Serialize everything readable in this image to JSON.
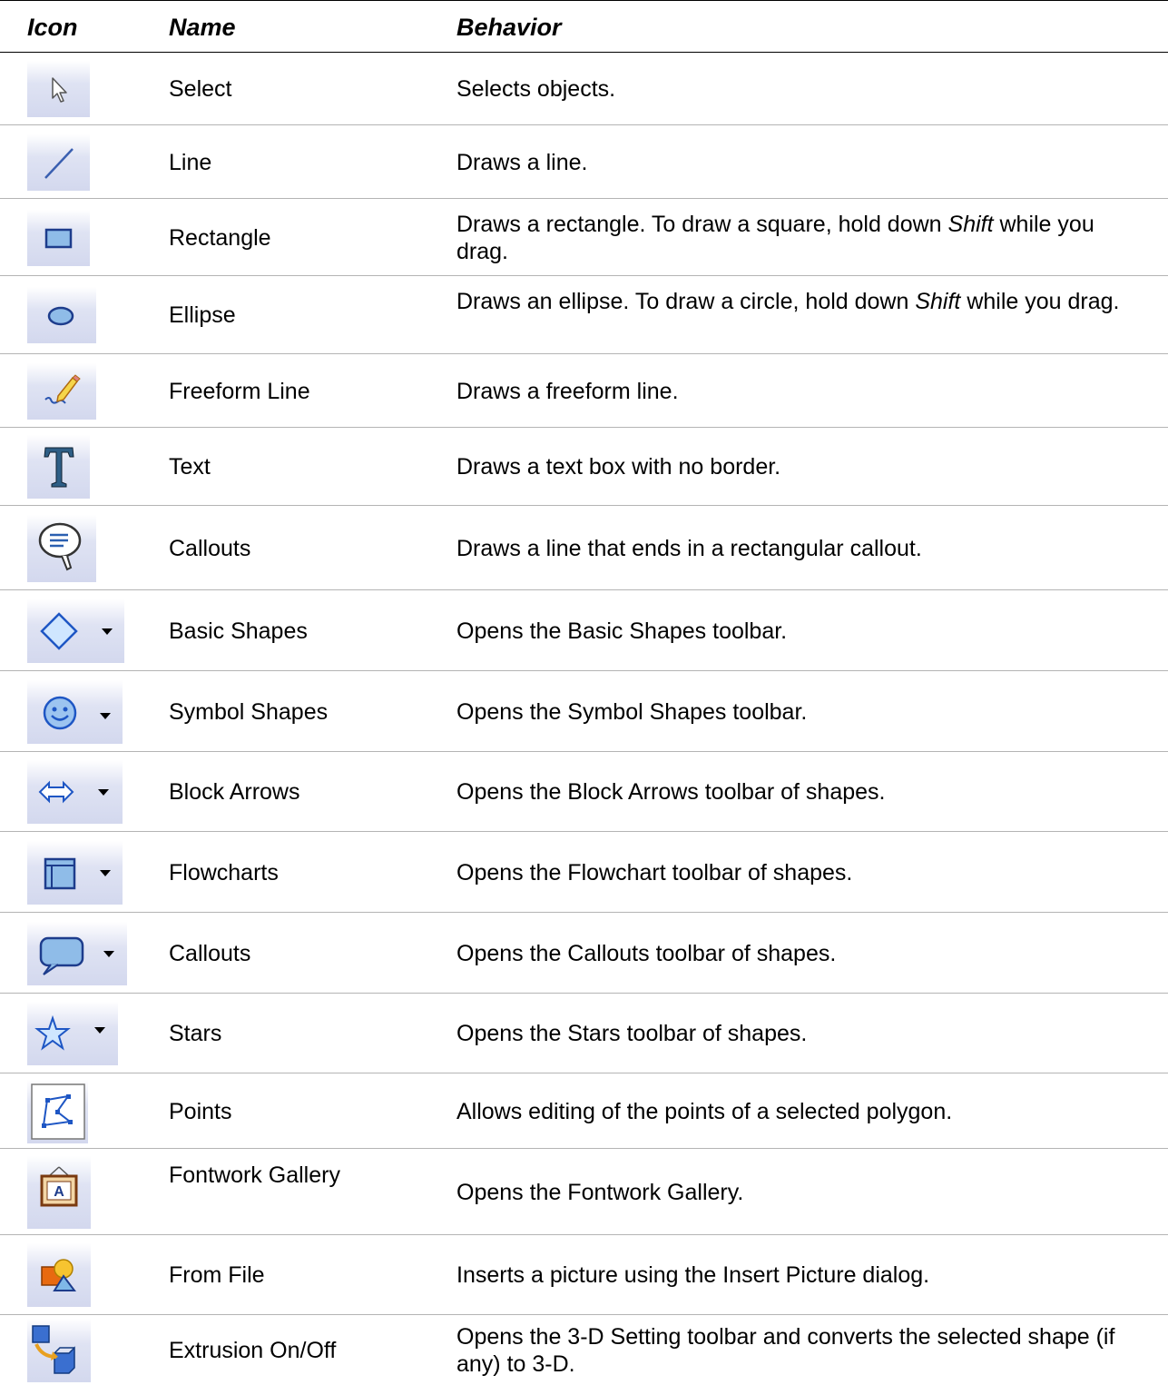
{
  "header": {
    "icon": "Icon",
    "name": "Name",
    "behavior": "Behavior"
  },
  "rows": [
    {
      "icon": "select-cursor-icon",
      "name": "Select",
      "behavior": [
        "Selects objects."
      ]
    },
    {
      "icon": "line-icon",
      "name": "Line",
      "behavior": [
        "Draws a line."
      ]
    },
    {
      "icon": "rectangle-icon",
      "name": "Rectangle",
      "behavior": [
        "Draws a rectangle. To draw a square, hold down ",
        "Shift",
        " while you drag."
      ]
    },
    {
      "icon": "ellipse-icon",
      "name": "Ellipse",
      "behavior": [
        "Draws an ellipse. To draw a circle, hold down ",
        "Shift",
        " while you drag."
      ]
    },
    {
      "icon": "freeform-pencil-icon",
      "name": "Freeform Line",
      "behavior": [
        "Draws a freeform line."
      ]
    },
    {
      "icon": "text-t-icon",
      "name": "Text",
      "behavior": [
        "Draws a text box with no border."
      ]
    },
    {
      "icon": "callout-bubble-icon",
      "name": "Callouts",
      "behavior": [
        "Draws a line that ends in a rectangular callout."
      ]
    },
    {
      "icon": "diamond-dropdown-icon",
      "name": "Basic Shapes",
      "behavior": [
        "Opens the Basic Shapes toolbar."
      ]
    },
    {
      "icon": "smiley-dropdown-icon",
      "name": "Symbol Shapes",
      "behavior": [
        "Opens the Symbol Shapes toolbar."
      ]
    },
    {
      "icon": "double-arrow-dropdown-icon",
      "name": "Block Arrows",
      "behavior": [
        "Opens the Block Arrows toolbar of shapes."
      ]
    },
    {
      "icon": "flowchart-dropdown-icon",
      "name": "Flowcharts",
      "behavior": [
        "Opens the Flowchart toolbar of shapes."
      ]
    },
    {
      "icon": "speech-bubble-dropdown-icon",
      "name": "Callouts",
      "behavior": [
        "Opens the Callouts toolbar of shapes."
      ]
    },
    {
      "icon": "star-dropdown-icon",
      "name": "Stars",
      "behavior": [
        "Opens the Stars toolbar of shapes."
      ]
    },
    {
      "icon": "points-polygon-icon",
      "name": "Points",
      "behavior": [
        "Allows editing of the points of a selected polygon."
      ]
    },
    {
      "icon": "fontwork-frame-icon",
      "name": "Fontwork Gallery",
      "behavior": [
        "Opens the Fontwork Gallery."
      ]
    },
    {
      "icon": "insert-picture-icon",
      "name": "From File",
      "behavior": [
        "Inserts a picture using the Insert Picture dialog."
      ]
    },
    {
      "icon": "extrusion-3d-icon",
      "name": "Extrusion On/Off",
      "behavior": [
        "Opens the 3-D Setting toolbar and converts the selected shape (if any) to 3-D."
      ]
    }
  ]
}
